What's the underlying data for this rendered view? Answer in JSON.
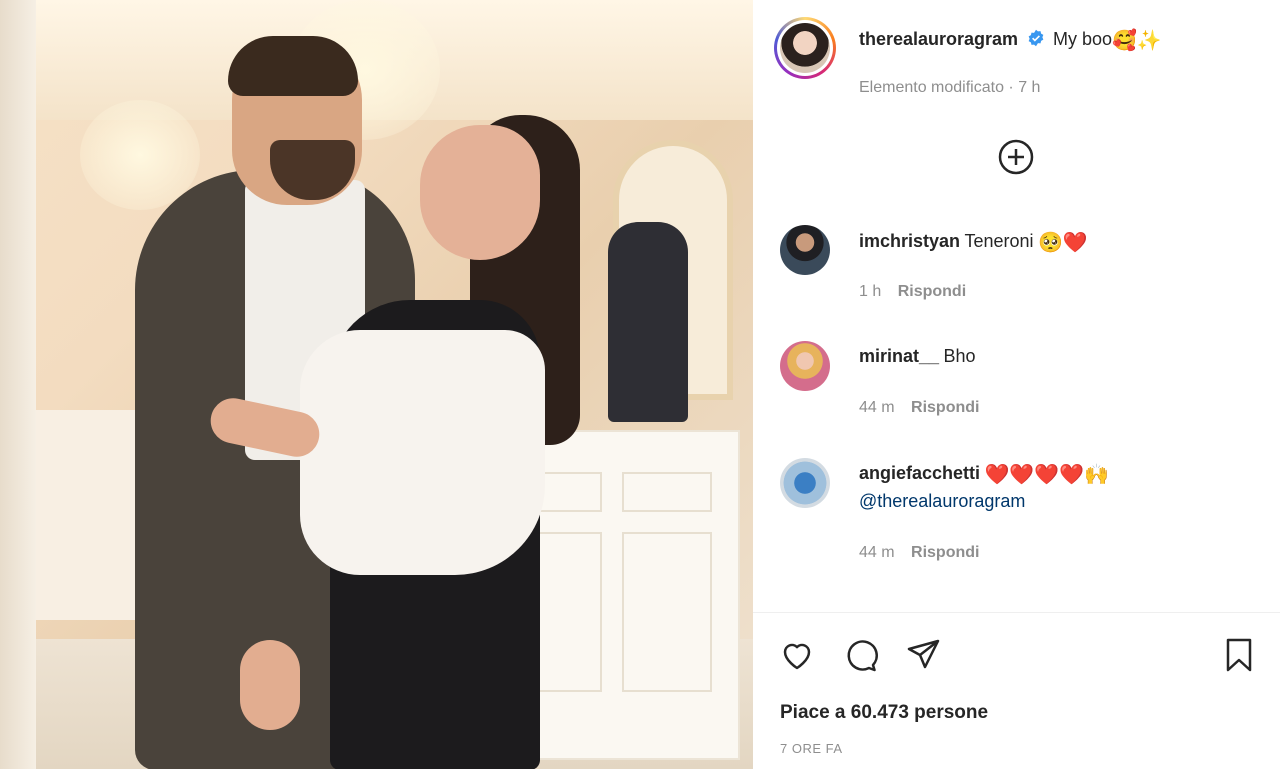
{
  "post": {
    "author": "therealauroragram",
    "caption": "My boo",
    "caption_emojis": "🥰✨",
    "edited_label": "Elemento modificato",
    "edited_time": "7 h",
    "verified_icon": "verified-badge-icon",
    "add_icon": "plus-circle-icon"
  },
  "comments": [
    {
      "username": "imchristyan",
      "text": "Teneroni",
      "emojis": "🥺❤️",
      "time": "1 h",
      "reply": "Rispondi"
    },
    {
      "username": "mirinat__",
      "text": "Bho",
      "emojis": "",
      "time": "44 m",
      "reply": "Rispondi"
    },
    {
      "username": "angiefacchetti",
      "text": "",
      "emojis": "❤️❤️❤️❤️🙌",
      "mention": "@therealauroragram",
      "time": "44 m",
      "reply": "Rispondi"
    }
  ],
  "actions": {
    "like_icon": "heart-icon",
    "comment_icon": "comment-icon",
    "share_icon": "send-icon",
    "save_icon": "bookmark-icon"
  },
  "likes_text": "Piace a 60.473 persone",
  "timestamp": "7 ORE FA",
  "colors": {
    "verified": "#3897f0",
    "link": "#00376b",
    "secondary_text": "#8e8e8e"
  }
}
